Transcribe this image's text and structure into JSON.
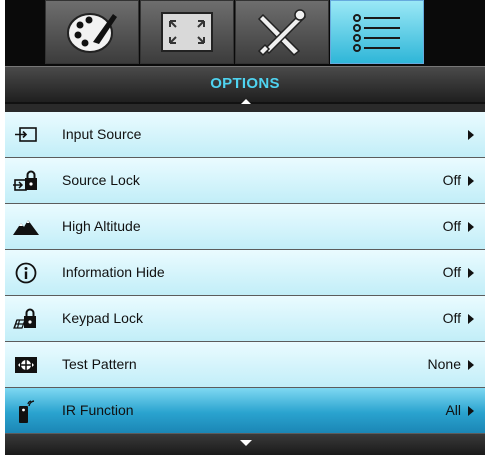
{
  "tabs": [
    {
      "icon": "palette-icon",
      "active": false
    },
    {
      "icon": "screen-resize-icon",
      "active": false
    },
    {
      "icon": "tools-icon",
      "active": false
    },
    {
      "icon": "options-list-icon",
      "active": true
    }
  ],
  "header": {
    "title": "OPTIONS"
  },
  "menu": {
    "items": [
      {
        "label": "Input Source",
        "value": "",
        "icon": "input-source-icon"
      },
      {
        "label": "Source Lock",
        "value": "Off",
        "icon": "source-lock-icon"
      },
      {
        "label": "High Altitude",
        "value": "Off",
        "icon": "mountain-icon"
      },
      {
        "label": "Information Hide",
        "value": "Off",
        "icon": "info-icon"
      },
      {
        "label": "Keypad Lock",
        "value": "Off",
        "icon": "keypad-lock-icon"
      },
      {
        "label": "Test Pattern",
        "value": "None",
        "icon": "test-pattern-icon"
      },
      {
        "label": "IR Function",
        "value": "All",
        "icon": "ir-remote-icon",
        "selected": true
      }
    ]
  },
  "colors": {
    "accent": "#4fd3f0",
    "row_bg": "#d6f4fb",
    "selected_bg": "#2aa3cf"
  }
}
